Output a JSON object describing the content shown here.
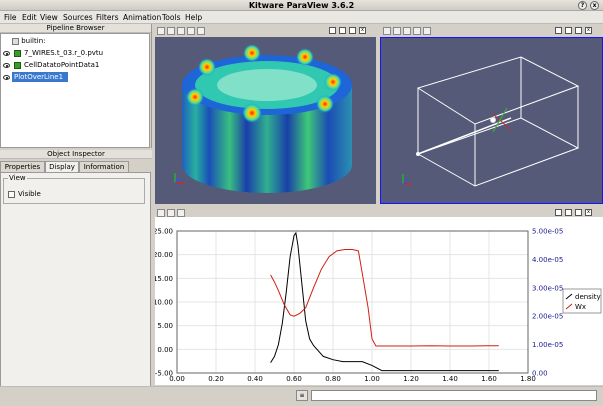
{
  "window": {
    "title": "Kitware ParaView 3.6.2"
  },
  "menu": [
    "File",
    "Edit",
    "View",
    "Sources",
    "Filters",
    "Animation",
    "Tools",
    "Help"
  ],
  "pipeline": {
    "header": "Pipeline Browser",
    "items": [
      {
        "label": "builtin:"
      },
      {
        "label": "7_WIRES.t_03.r_0.pvtu"
      },
      {
        "label": "CellDatatoPointData1"
      },
      {
        "label": "PlotOverLine1"
      }
    ]
  },
  "inspector": {
    "header": "Object Inspector",
    "tabs": [
      "Properties",
      "Display",
      "Information"
    ],
    "active_tab": "Display",
    "group_label": "View",
    "visible_label": "Visible"
  },
  "chart_data": {
    "type": "line",
    "x_ticks": [
      "0.00",
      "0.20",
      "0.40",
      "0.60",
      "0.80",
      "1.00",
      "1.20",
      "1.40",
      "1.60",
      "1.80"
    ],
    "y_left_ticks": [
      "-5.00",
      "0.00",
      "5.00",
      "10.00",
      "15.00",
      "20.00",
      "25.00"
    ],
    "y_right_ticks": [
      "0.00",
      "1.00e-05",
      "2.00e-05",
      "3.00e-05",
      "4.00e-05",
      "5.00e-05"
    ],
    "xlim": [
      0,
      1.8
    ],
    "ylim_left": [
      -5,
      25
    ],
    "ylim_right": [
      0,
      5e-05
    ],
    "legend_position": "right",
    "series": [
      {
        "name": "density",
        "axis": "left",
        "color": "#000000",
        "x": [
          0.48,
          0.5,
          0.52,
          0.54,
          0.56,
          0.58,
          0.6,
          0.61,
          0.62,
          0.64,
          0.66,
          0.68,
          0.7,
          0.75,
          0.8,
          0.85,
          0.9,
          0.95,
          1.0,
          1.05,
          1.2,
          1.4,
          1.6,
          1.65
        ],
        "y": [
          -2.8,
          -1.5,
          1.0,
          5.5,
          12.0,
          19.5,
          24.0,
          24.6,
          22.0,
          14.0,
          6.0,
          2.2,
          0.8,
          -1.5,
          -2.2,
          -2.6,
          -2.6,
          -2.6,
          -3.4,
          -4.5,
          -4.5,
          -4.5,
          -4.5,
          -4.5
        ]
      },
      {
        "name": "Wx",
        "axis": "right",
        "color": "#d02010",
        "x": [
          0.48,
          0.5,
          0.52,
          0.55,
          0.58,
          0.6,
          0.63,
          0.66,
          0.7,
          0.74,
          0.78,
          0.82,
          0.86,
          0.9,
          0.93,
          0.95,
          0.98,
          1.0,
          1.02,
          1.1,
          1.2,
          1.3,
          1.4,
          1.5,
          1.6,
          1.65
        ],
        "y": [
          3.45e-05,
          3.2e-05,
          2.9e-05,
          2.4e-05,
          2.05e-05,
          2e-05,
          2.1e-05,
          2.3e-05,
          3e-05,
          3.65e-05,
          4.1e-05,
          4.3e-05,
          4.35e-05,
          4.35e-05,
          4.3e-05,
          3.5e-05,
          2.3e-05,
          1.2e-05,
          9.5e-06,
          9.5e-06,
          9.5e-06,
          9.6e-06,
          9.5e-06,
          9.5e-06,
          9.6e-06,
          9.6e-06
        ]
      }
    ]
  },
  "colors": {
    "view_background": "#545a78",
    "active_view_border": "#1414ff",
    "density_line": "#000000",
    "wx_line": "#d02010"
  }
}
